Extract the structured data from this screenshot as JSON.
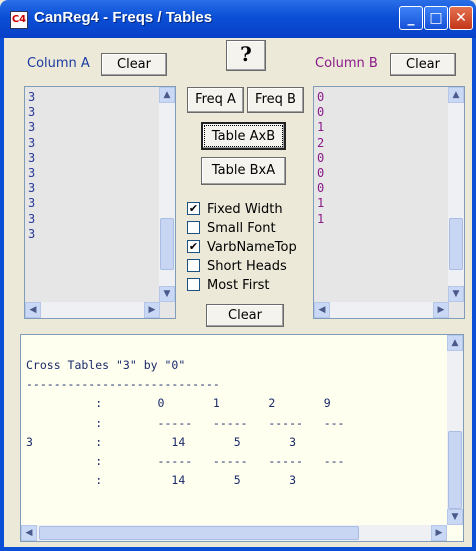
{
  "window": {
    "title": "CanReg4 - Freqs / Tables",
    "app_icon_text": "C4",
    "minimize": "_",
    "maximize": "□",
    "close": "✕"
  },
  "help_button": "?",
  "column_a": {
    "label": "Column A",
    "clear": "Clear",
    "items": [
      "3",
      "3",
      "3",
      "3",
      "3",
      "3",
      "3",
      "3",
      "3",
      "3"
    ]
  },
  "column_b": {
    "label": "Column B",
    "clear": "Clear",
    "items": [
      "0",
      "0",
      "1",
      "2",
      "0",
      "0",
      "0",
      "1",
      "1"
    ]
  },
  "buttons": {
    "freq_a": "Freq A",
    "freq_b": "Freq B",
    "table_axb": "Table AxB",
    "table_bxa": "Table BxA",
    "clear": "Clear"
  },
  "options": [
    {
      "label": "Fixed Width",
      "checked": true
    },
    {
      "label": "Small Font",
      "checked": false
    },
    {
      "label": "VarbNameTop",
      "checked": true
    },
    {
      "label": "Short Heads",
      "checked": false
    },
    {
      "label": "Most First",
      "checked": false
    }
  ],
  "output": {
    "lines": [
      "Cross Tables \"3\" by \"0\"",
      "----------------------------",
      "          :        0       1       2       9",
      "          :        -----   -----   -----   ---",
      "3         :          14       5       3",
      "          :        -----   -----   -----   ---",
      "          :          14       5       3"
    ]
  }
}
